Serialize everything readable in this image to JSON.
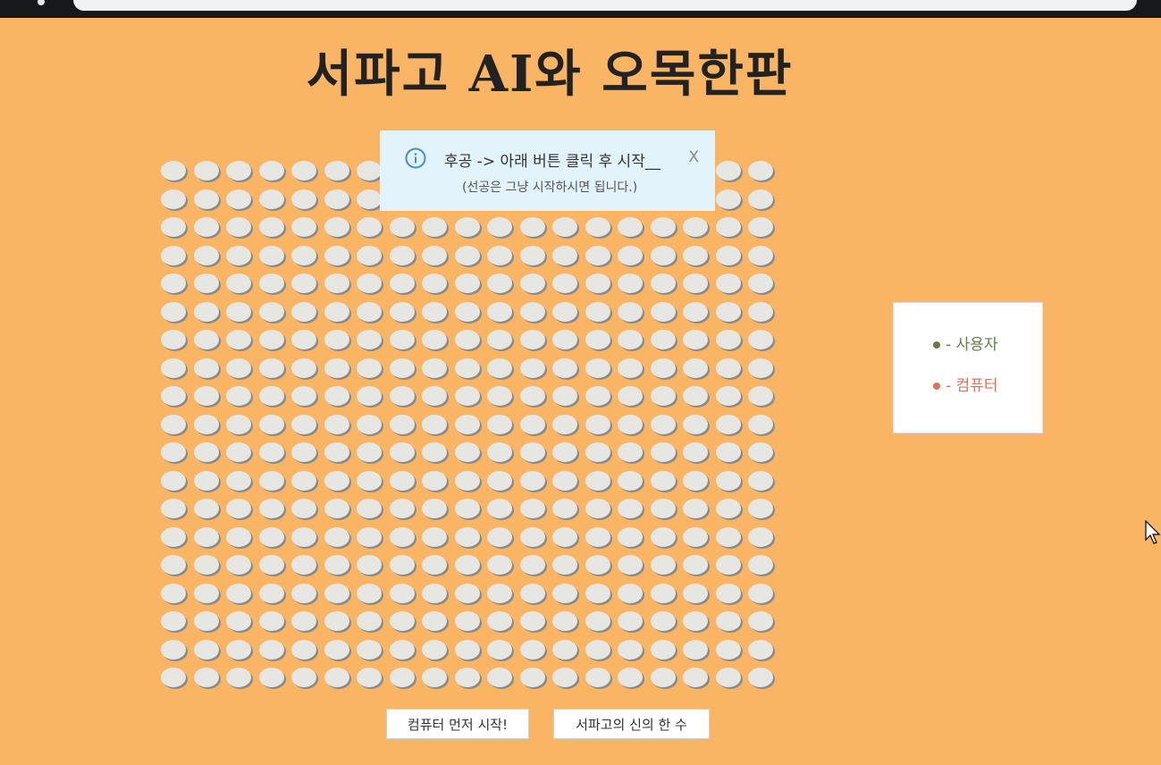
{
  "title": "서파고 AI와 오목한판",
  "board": {
    "rows": 19,
    "cols": 19
  },
  "alert": {
    "icon": "info-icon",
    "message": "후공 -> 아래 버튼 클릭 후 시작__",
    "sub_message": "(선공은 그냥 시작하시면 됩니다.)",
    "close_label": "X"
  },
  "legend": {
    "user": "- 사용자",
    "computer": "- 컴퓨터",
    "colors": {
      "user": "#6c7a48",
      "computer": "#e07060"
    }
  },
  "buttons": {
    "computer_first": "컴퓨터 먼저 시작!",
    "god_move": "서파고의 신의 한 수"
  }
}
